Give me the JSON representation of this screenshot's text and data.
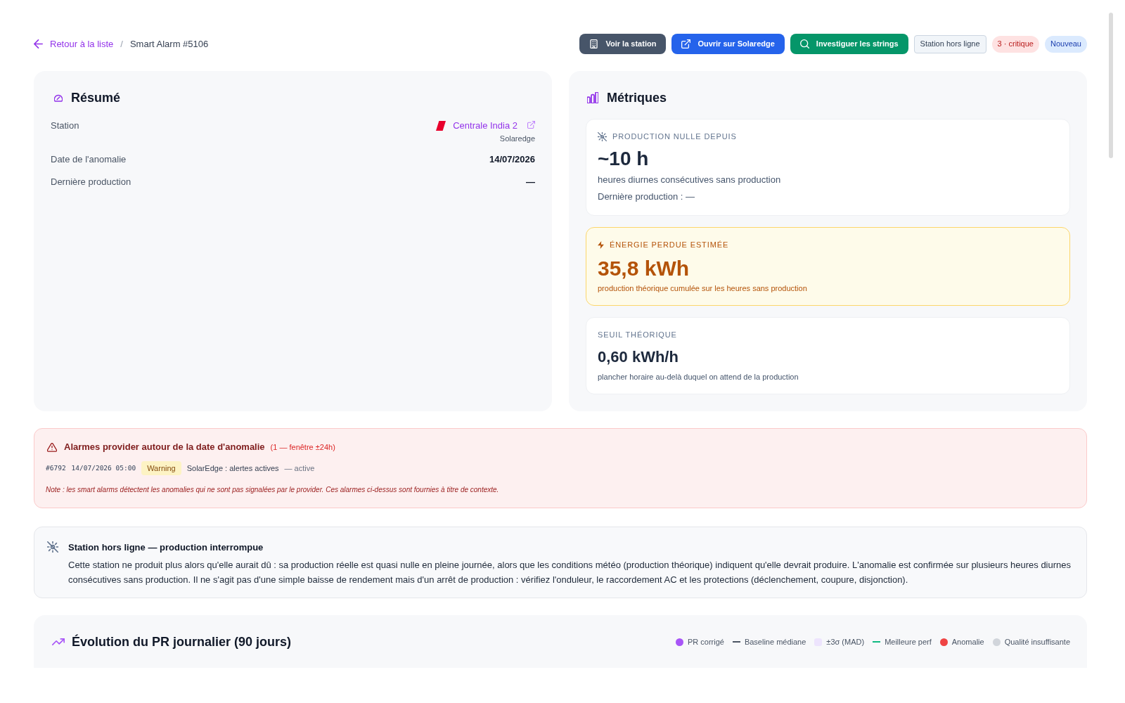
{
  "breadcrumb": {
    "back_link": "Retour à la liste",
    "separator": "/",
    "current": "Smart Alarm #5106"
  },
  "actions": [
    {
      "label": "Voir la station",
      "kind": "station"
    },
    {
      "label": "Ouvrir sur Solaredge",
      "kind": "external"
    },
    {
      "label": "Investiguer les strings",
      "kind": "investigate"
    }
  ],
  "badges": [
    {
      "label": "Station hors ligne",
      "kind": "status"
    },
    {
      "label": "3 · critique",
      "kind": "severity"
    },
    {
      "label": "Nouveau",
      "kind": "state"
    }
  ],
  "summary": {
    "title": "Résumé",
    "rows": [
      {
        "label": "Station",
        "kind": "station",
        "value": "Centrale India 2",
        "provider": "Solaredge"
      },
      {
        "label": "Date de l'anomalie",
        "kind": "text",
        "value": "14/07/2026"
      },
      {
        "label": "Dernière production",
        "kind": "text",
        "value": "—"
      }
    ]
  },
  "metrics": {
    "title": "Métriques",
    "cards": [
      {
        "kind": "duration",
        "label": "PRODUCTION NULLE DEPUIS",
        "value": "~10 h",
        "description": "heures diurnes consécutives sans production",
        "detail": "Dernière production : —"
      },
      {
        "kind": "loss",
        "label": "ÉNERGIE PERDUE ESTIMÉE",
        "value": "35,8 kWh",
        "description": "production théorique cumulée sur les heures sans production"
      },
      {
        "kind": "threshold",
        "label": "SEUIL THÉORIQUE",
        "value": "0,60 kWh/h",
        "description": "plancher horaire au-delà duquel on attend de la production"
      }
    ]
  },
  "provider_alarms": {
    "title": "Alarmes provider autour de la date d'anomalie",
    "count_note": "(1 — fenêtre ±24h)",
    "alarms": [
      {
        "id": "#6792",
        "time": "14/07/2026 05:00",
        "level": "Warning",
        "message": "SolarEdge : alertes actives",
        "status": "— active"
      }
    ],
    "note": "Note : les smart alarms détectent les anomalies qui ne sont pas signalées par le provider. Ces alarmes ci-dessus sont fournies à titre de contexte."
  },
  "diagnosis": {
    "title": "Station hors ligne — production interrompue",
    "text": "Cette station ne produit plus alors qu'elle aurait dû : sa production réelle est quasi nulle en pleine journée, alors que les conditions météo (production théorique) indiquent qu'elle devrait produire. L'anomalie est confirmée sur plusieurs heures diurnes consécutives sans production. Il ne s'agit pas d'une simple baisse de rendement mais d'un arrêt de production : vérifiez l'onduleur, le raccordement AC et les protections (déclenchement, coupure, disjonction)."
  },
  "pr_chart": {
    "title": "Évolution du PR journalier (90 jours)",
    "legend": [
      {
        "label": "PR corrigé",
        "kind": "dot",
        "color": "#a855f7"
      },
      {
        "label": "Baseline médiane",
        "kind": "line",
        "color": "#4b5563"
      },
      {
        "label": "±3σ (MAD)",
        "kind": "square",
        "color": "#ede4fd"
      },
      {
        "label": "Meilleure perf",
        "kind": "line",
        "color": "#10b981"
      },
      {
        "label": "Anomalie",
        "kind": "dot",
        "color": "#ef4444"
      },
      {
        "label": "Qualité insuffisante",
        "kind": "dot",
        "color": "#d1d5db"
      }
    ]
  }
}
